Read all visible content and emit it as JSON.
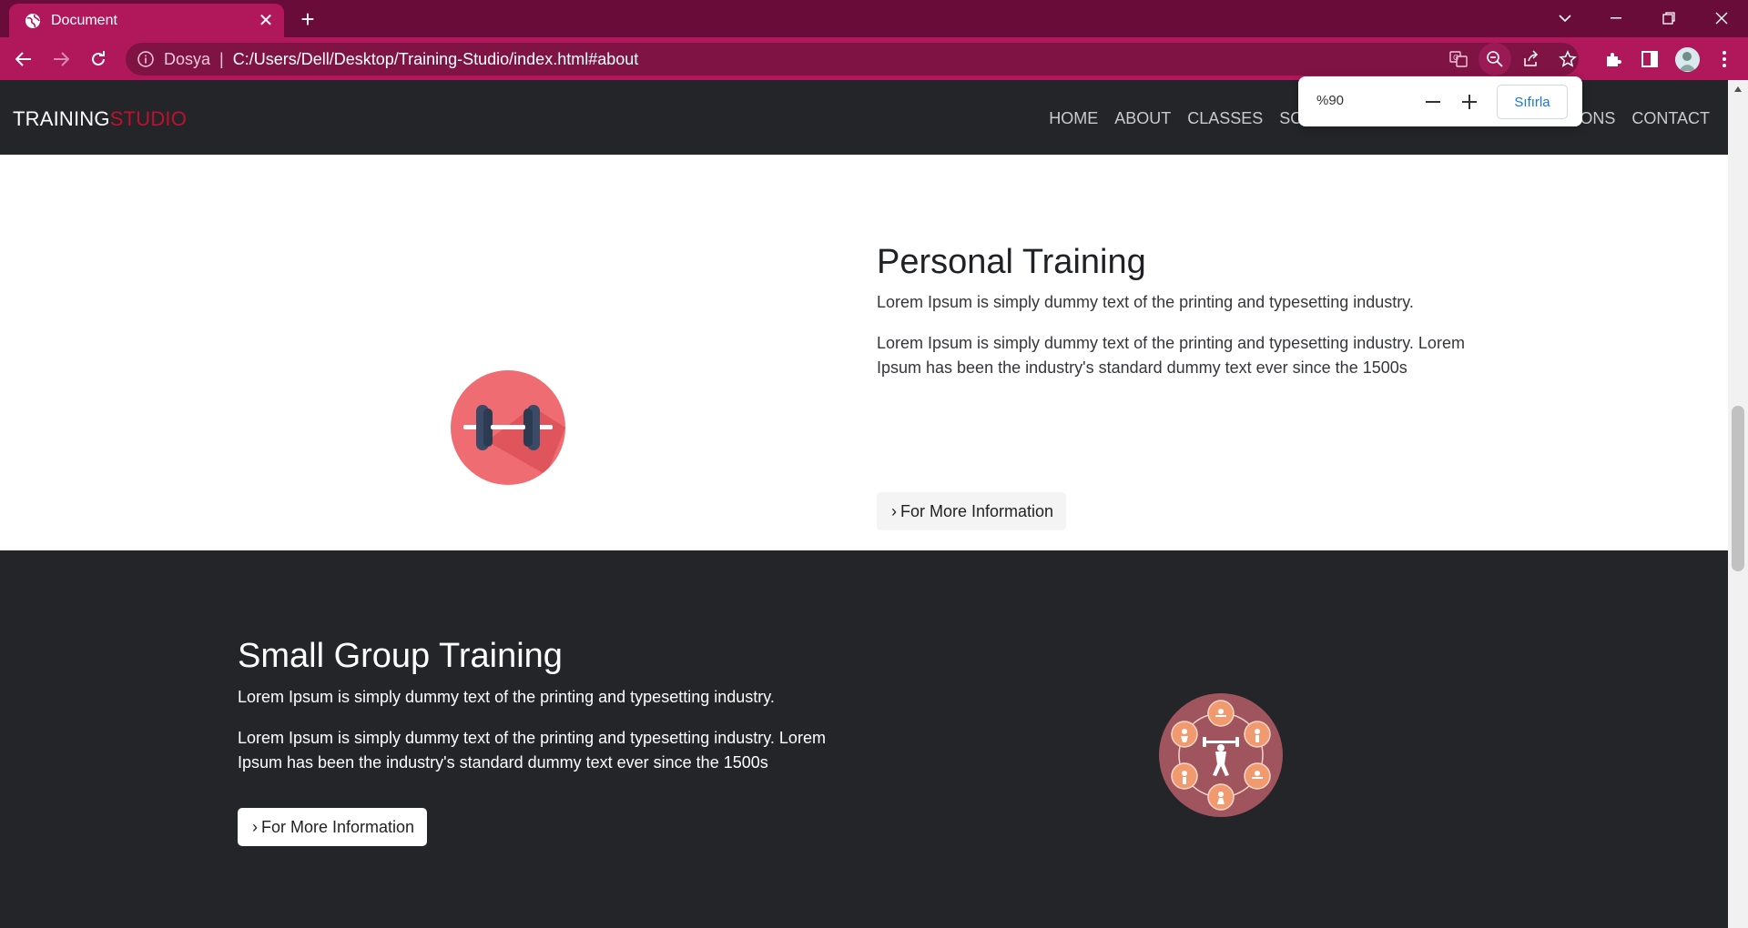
{
  "browser": {
    "tab_title": "Document",
    "omnibox_scheme": "Dosya",
    "omnibox_separator": "|",
    "url": "C:/Users/Dell/Desktop/Training-Studio/index.html#about",
    "zoom_level": "%90",
    "zoom_reset_label": "Sıfırla"
  },
  "site": {
    "logo_part1": "TRAINING",
    "logo_part2": "STUDIO",
    "nav": {
      "home": "HOME",
      "about": "ABOUT",
      "classes": "CLASSES",
      "schedule_visible": "SCHE",
      "sessions_visible": "ONS",
      "contact": "CONTACT"
    }
  },
  "sections": {
    "personal": {
      "title": "Personal Training",
      "lead": "Lorem Ipsum is simply dummy text of the printing and typesetting industry.",
      "body_line1": "Lorem Ipsum is simply dummy text of the printing and typesetting industry. Lorem",
      "body_line2": "Ipsum has been the industry's standard dummy text ever since the 1500s",
      "button": "For More Information"
    },
    "group": {
      "title": "Small Group Training",
      "lead": "Lorem Ipsum is simply dummy text of the printing and typesetting industry.",
      "body_line1": "Lorem Ipsum is simply dummy text of the printing and typesetting industry. Lorem",
      "body_line2": "Ipsum has been the industry's standard dummy text ever since the 1500s",
      "button": "For More Information"
    }
  },
  "icons": {
    "dumbbell": "dumbbell-icon",
    "group_training": "group-training-icon"
  },
  "colors": {
    "tab_strip": "#6a0c39",
    "toolbar": "#b0185b",
    "site_dark": "#232529",
    "logo_accent": "#c0102f"
  }
}
